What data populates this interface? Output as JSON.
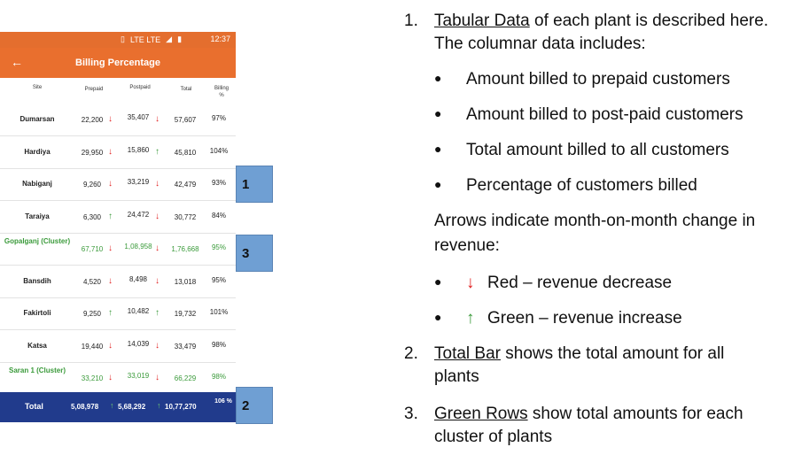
{
  "status_bar": {
    "time": "12:37",
    "indicators": "LTE LTE"
  },
  "app_bar": {
    "back_icon": "arrow-left-icon",
    "title": "Billing Percentage"
  },
  "table": {
    "headers": {
      "site": "Site",
      "prepaid": "Prepaid",
      "postpaid": "Postpaid",
      "total": "Total",
      "billing": "Billing %"
    },
    "rows": [
      {
        "site": "Dumarsan",
        "prepaid": "22,200",
        "prepaid_trend": "down",
        "postpaid": "35,407",
        "postpaid_trend": "down",
        "total": "57,607",
        "billing": "97%",
        "cluster": false
      },
      {
        "site": "Hardiya",
        "prepaid": "29,950",
        "prepaid_trend": "down",
        "postpaid": "15,860",
        "postpaid_trend": "up",
        "total": "45,810",
        "billing": "104%",
        "cluster": false
      },
      {
        "site": "Nabiganj",
        "prepaid": "9,260",
        "prepaid_trend": "down",
        "postpaid": "33,219",
        "postpaid_trend": "down",
        "total": "42,479",
        "billing": "93%",
        "cluster": false
      },
      {
        "site": "Taraiya",
        "prepaid": "6,300",
        "prepaid_trend": "up",
        "postpaid": "24,472",
        "postpaid_trend": "down",
        "total": "30,772",
        "billing": "84%",
        "cluster": false
      },
      {
        "site": "Gopalganj (Cluster)",
        "prepaid": "67,710",
        "prepaid_trend": "down",
        "postpaid": "1,08,958",
        "postpaid_trend": "down",
        "total": "1,76,668",
        "billing": "95%",
        "cluster": true
      },
      {
        "site": "Bansdih",
        "prepaid": "4,520",
        "prepaid_trend": "down",
        "postpaid": "8,498",
        "postpaid_trend": "down",
        "total": "13,018",
        "billing": "95%",
        "cluster": false
      },
      {
        "site": "Fakirtoli",
        "prepaid": "9,250",
        "prepaid_trend": "up",
        "postpaid": "10,482",
        "postpaid_trend": "up",
        "total": "19,732",
        "billing": "101%",
        "cluster": false
      },
      {
        "site": "Katsa",
        "prepaid": "19,440",
        "prepaid_trend": "down",
        "postpaid": "14,039",
        "postpaid_trend": "down",
        "total": "33,479",
        "billing": "98%",
        "cluster": false
      },
      {
        "site": "Saran 1 (Cluster)",
        "prepaid": "33,210",
        "prepaid_trend": "down",
        "postpaid": "33,019",
        "postpaid_trend": "down",
        "total": "66,229",
        "billing": "98%",
        "cluster": true
      }
    ],
    "total": {
      "label": "Total",
      "prepaid": "5,08,978",
      "prepaid_trend": "up",
      "postpaid": "5,68,292",
      "postpaid_trend": "up",
      "total": "10,77,270",
      "billing": "106 %"
    }
  },
  "callouts": {
    "one": "1",
    "two": "2",
    "three": "3"
  },
  "colors": {
    "orange": "#e96f2e",
    "total_bar": "#213b8c",
    "callout": "#6f9fd3",
    "decrease": "#e02020",
    "increase": "#3a9a3a"
  },
  "notes": {
    "item1_num": "1.",
    "item1_underlined": "Tabular Data",
    "item1_rest": " of each plant is described here.",
    "item1_line2": "The columnar data includes:",
    "bullets": [
      "Amount billed to prepaid customers",
      "Amount billed to post-paid customers",
      "Total amount billed to all customers",
      "Percentage of customers billed"
    ],
    "arrows_line1": "Arrows indicate month-on-month change in",
    "arrows_line2": "revenue:",
    "red_label": "Red – revenue decrease",
    "green_label": "Green – revenue increase",
    "item2_num": "2.",
    "item2_underlined": "Total Bar",
    "item2_rest": " shows the total amount for all",
    "item2_line2": "plants",
    "item3_num": "3.",
    "item3_underlined": "Green Rows",
    "item3_rest": " show total amounts for each",
    "item3_line2": "cluster of plants"
  }
}
